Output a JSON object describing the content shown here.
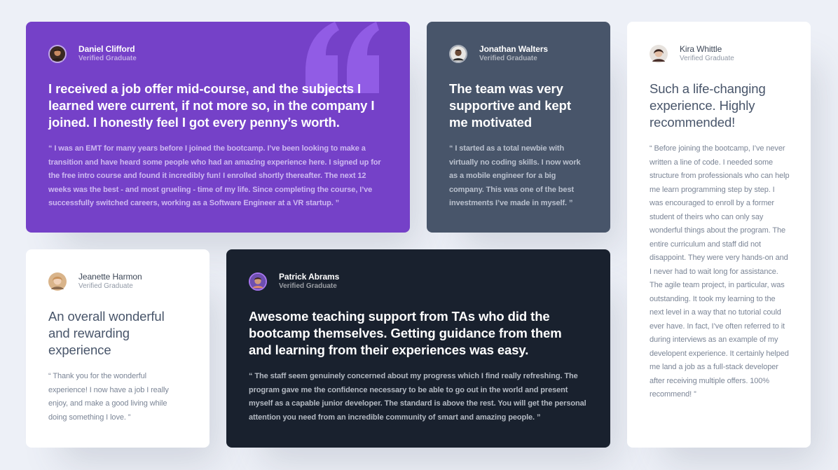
{
  "testimonials": [
    {
      "name": "Daniel Clifford",
      "role": "Verified Graduate",
      "headline": "I received a job offer mid-course, and the subjects I learned were current, if not more so, in the company I joined. I honestly feel I got every penny’s worth.",
      "quote": "“ I was an EMT for many years before I joined the bootcamp. I’ve been looking to make a transition and have heard some people who had an amazing experience here. I signed up for the free intro course and found it incredibly fun! I enrolled shortly thereafter. The next 12 weeks was the best - and most grueling - time of my life. Since completing the course, I’ve successfully switched careers, working as a Software Engineer at a VR startup. ”",
      "theme_color": "#7541c8"
    },
    {
      "name": "Jonathan Walters",
      "role": "Verified Graduate",
      "headline": "The team was very supportive and kept me motivated",
      "quote": "“ I started as a total newbie with virtually no coding skills. I now work as a mobile engineer for a big company. This was one of the best investments I’ve made in myself. ”",
      "theme_color": "#48556a"
    },
    {
      "name": "Jeanette Harmon",
      "role": "Verified Graduate",
      "headline": "An overall wonderful and rewarding experience",
      "quote": "“ Thank you for the wonderful experience! I now have a job I really enjoy, and make a good living while doing something I love. ”",
      "theme_color": "#ffffff"
    },
    {
      "name": "Patrick Abrams",
      "role": "Verified Graduate",
      "headline": "Awesome teaching support from TAs who did the bootcamp themselves. Getting guidance from them and learning from their experiences was easy.",
      "quote": "“ The staff seem genuinely concerned about my progress which I find really refreshing. The program gave me the confidence necessary to be able to go out in the world and present myself as a capable junior developer. The standard is above the rest. You will get the personal attention you need from an incredible community of smart and amazing people. ”",
      "theme_color": "#19212e"
    },
    {
      "name": "Kira Whittle",
      "role": "Verified Graduate",
      "headline": "Such a life-changing experience. Highly recommended!",
      "quote": "“ Before joining the bootcamp, I’ve never written a line of code. I needed some structure from professionals who can help me learn programming step by step. I was encouraged to enroll by a former student of theirs who can only say wonderful things about the program. The entire curriculum and staff did not disappoint. They were very hands-on and I never had to wait long for assistance. The agile team project, in particular, was outstanding. It took my learning to the next level in a way that no tutorial could ever have. In fact, I’ve often referred to it during interviews as an example of my developent experience. It certainly helped me land a job as a full-stack developer after receiving multiple offers. 100% recommend! ”",
      "theme_color": "#ffffff"
    }
  ],
  "icons": {
    "avatar": "avatar-icon",
    "quote_mark": "quotation-mark-icon"
  },
  "page_background": "#edf0f7"
}
